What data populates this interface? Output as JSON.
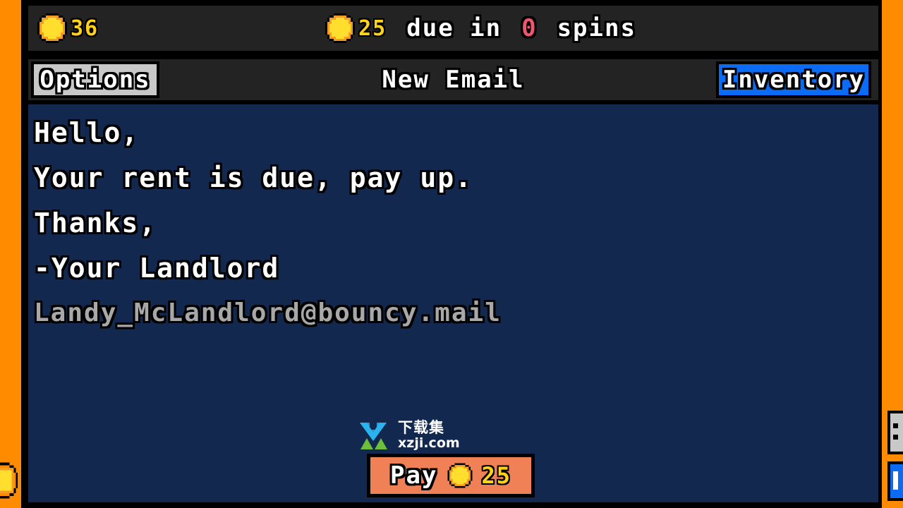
{
  "theme": {
    "frame_orange": "#FF8C00",
    "bar_dark": "#232323",
    "panel_navy": "#13284F",
    "accent_blue": "#0B6BF5",
    "accent_gray": "#C8C8C8",
    "pay_salmon": "#F08056",
    "coin_yellow": "#FFD21A",
    "warning_pink": "#F0566E",
    "text_white": "#FFFFFF",
    "text_gray": "#A8A8A8",
    "outline_black": "#000000"
  },
  "status_bar": {
    "coin_icon": "coin-icon",
    "coin_balance": "36",
    "rent_coin_icon": "coin-icon",
    "rent_amount": "25",
    "due_prefix": "due in",
    "due_spins": "0",
    "due_suffix": "spins"
  },
  "nav": {
    "options_label": "Options",
    "title": "New Email",
    "inventory_label": "Inventory"
  },
  "email": {
    "lines": [
      "Hello,",
      "Your rent is due, pay up.",
      "Thanks,",
      "-Your Landlord"
    ],
    "address": "Landy_McLandlord@bouncy.mail"
  },
  "pay_button": {
    "label": "Pay",
    "coin_icon": "coin-icon",
    "amount": "25"
  },
  "watermark": {
    "logo_icon": "download-arrow-icon",
    "brand_cn": "下载集",
    "brand_url": "xzji.com"
  }
}
